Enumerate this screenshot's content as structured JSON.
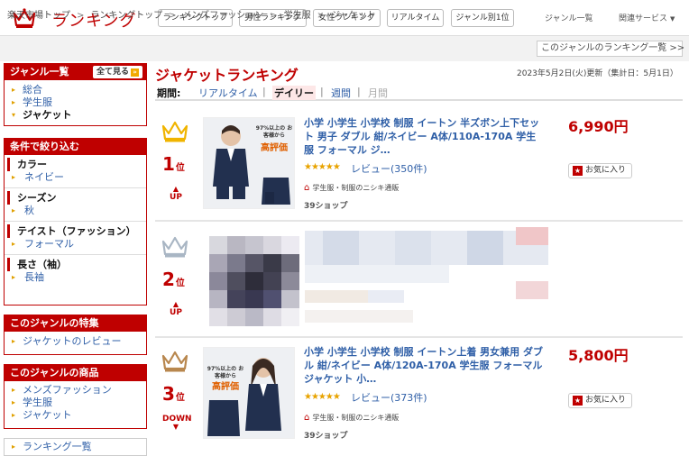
{
  "header": {
    "title": "ランキング",
    "nav": [
      "ランキングトップ",
      "男性ランキング",
      "女性ランキング",
      "リアルタイム",
      "ジャンル別1位"
    ],
    "genre_list": "ジャンル一覧",
    "related_services": "関連サービス",
    "caret": "▼"
  },
  "breadcrumb": {
    "items": [
      "楽天市場トップ",
      "ランキングトップ",
      "メンズファッション",
      "学生服",
      "ジャケット"
    ],
    "sep": ">",
    "right_link": "このジャンルのランキング一覧 >>"
  },
  "sidebar": {
    "genre": {
      "title": "ジャンル一覧",
      "see_all": "全て見る",
      "see_all_icon": "»",
      "items": [
        "総合",
        "学生服",
        "ジャケット"
      ]
    },
    "filter": {
      "title": "条件で絞り込む",
      "groups": [
        {
          "head": "カラー",
          "value": "ネイビー"
        },
        {
          "head": "シーズン",
          "value": "秋"
        },
        {
          "head": "テイスト（ファッション）",
          "value": "フォーマル"
        },
        {
          "head": "長さ（袖）",
          "value": "長袖"
        }
      ]
    },
    "feature": {
      "title": "このジャンルの特集",
      "items": [
        "ジャケットのレビュー"
      ]
    },
    "products": {
      "title": "このジャンルの商品",
      "items": [
        "メンズファッション",
        "学生服",
        "ジャケット"
      ]
    },
    "ranking_list": {
      "title": "ランキング一覧"
    }
  },
  "main": {
    "title": "ジャケットランキング",
    "updated": "2023年5月2日(火)更新（集計日：5月1日）",
    "period_label": "期間:",
    "periods": [
      "リアルタイム",
      "デイリー",
      "週間",
      "月間"
    ],
    "period_sep": "|"
  },
  "ranks": [
    {
      "rank": "1",
      "rank_suffix": "位",
      "change": "UP",
      "change_icon": "▲",
      "title": "小学 小学生 小学校 制服 イートン 半ズボン上下セット 男子 ダブル 紺/ネイビー A体/110A-170A 学生服 フォーマル ジ…",
      "stars": "★★★★★",
      "review": "レビュー(350件)",
      "shop": "学生服・制服のニシキ通販",
      "shop_icon": "⌂",
      "shop39": "39ショップ",
      "price": "6,990円",
      "fav": "お気に入り",
      "fav_icon": "★",
      "img_badge": "97%以上の お客様から",
      "img_badge2": "高評価",
      "crown_color": "#f0b400"
    },
    {
      "rank": "2",
      "rank_suffix": "位",
      "change": "UP",
      "change_icon": "▲",
      "crown_color": "#a9b6c4"
    },
    {
      "rank": "3",
      "rank_suffix": "位",
      "change": "DOWN",
      "change_icon": "▼",
      "title": "小学 小学生 小学校 制服 イートン上着 男女兼用 ダブル 紺/ネイビー A体/120A-170A 学生服 フォーマル ジャケット 小…",
      "stars": "★★★★★",
      "review": "レビュー(373件)",
      "shop": "学生服・制服のニシキ通販",
      "shop_icon": "⌂",
      "shop39": "39ショップ",
      "price": "5,800円",
      "fav": "お気に入り",
      "fav_icon": "★",
      "img_badge": "97%以上の お客様から",
      "img_badge2": "高評価",
      "crown_color": "#b8874e"
    }
  ],
  "colors": {
    "brand": "#bf0000",
    "link": "#2f5fa7",
    "gold": "#f0b400",
    "silver": "#a9b6c4",
    "bronze": "#b8874e"
  },
  "icons": {
    "logo": "crown-icon",
    "star": "star-icon",
    "shop": "home-icon"
  }
}
